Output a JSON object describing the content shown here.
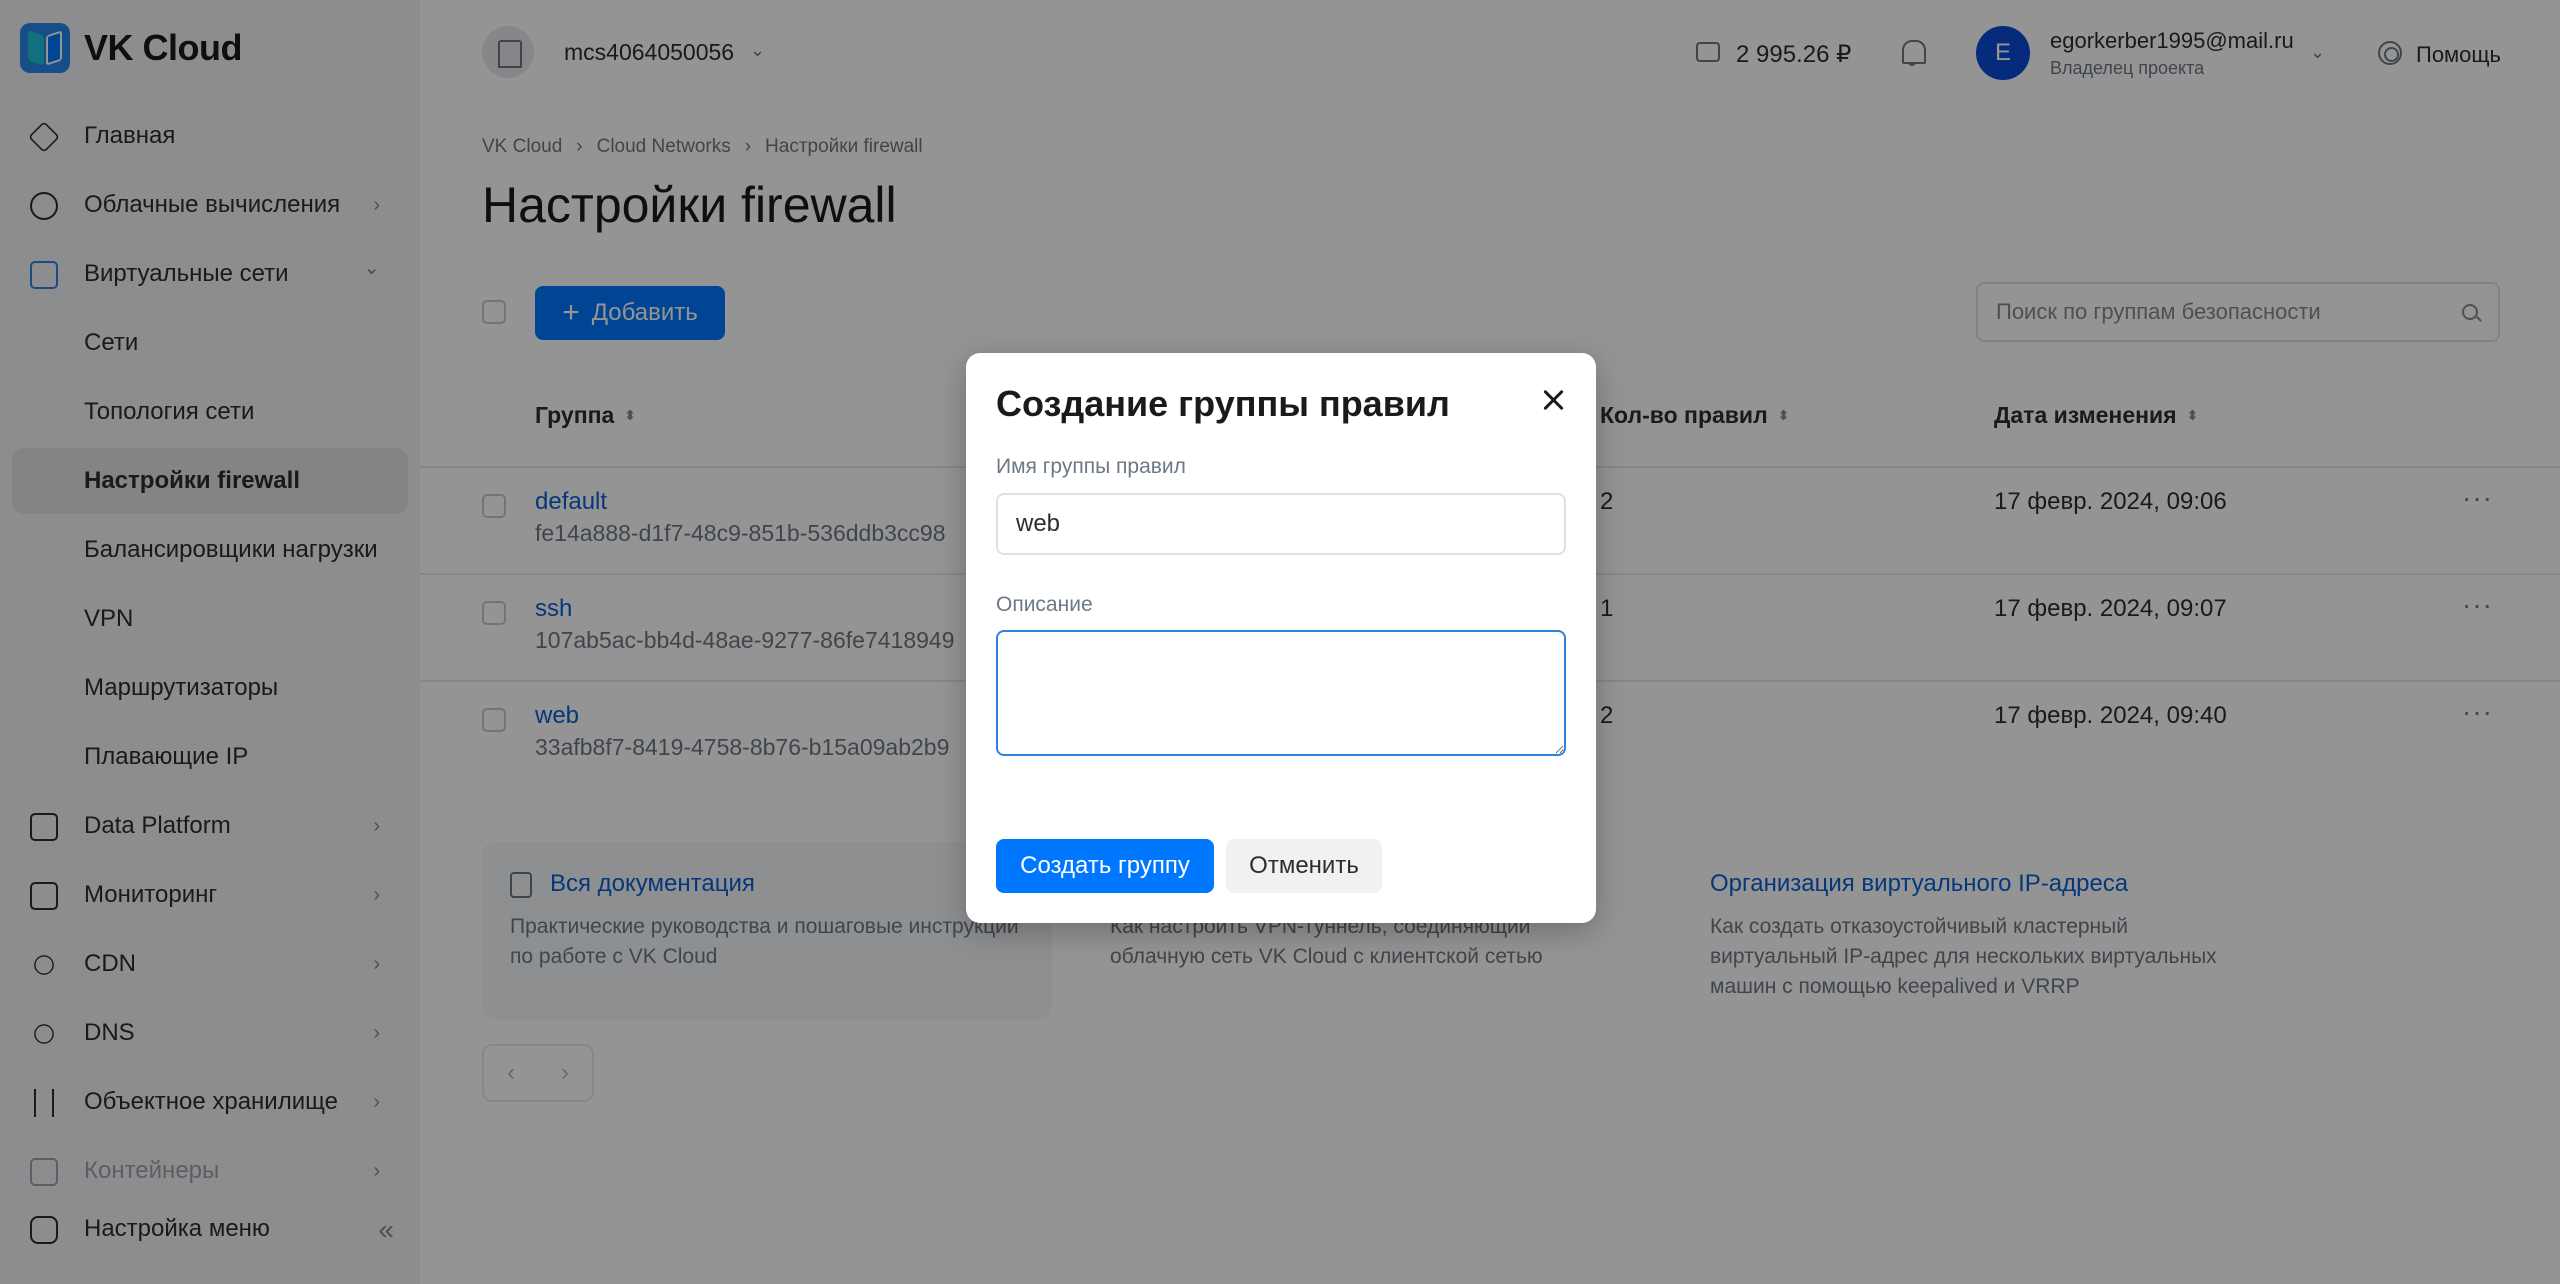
{
  "app": {
    "logo_text": "VK Cloud"
  },
  "sidebar": {
    "items": [
      {
        "label": "Главная",
        "icon": "cube-icon",
        "chevron": ""
      },
      {
        "label": "Облачные вычисления",
        "icon": "compute-icon",
        "chevron": "›"
      },
      {
        "label": "Виртуальные сети",
        "icon": "network-icon",
        "chevron": "⌄"
      },
      {
        "label": "Сети",
        "icon": "",
        "chevron": ""
      },
      {
        "label": "Топология сети",
        "icon": "",
        "chevron": ""
      },
      {
        "label": "Настройки firewall",
        "icon": "",
        "chevron": ""
      },
      {
        "label": "Балансировщики нагрузки",
        "icon": "",
        "chevron": ""
      },
      {
        "label": "VPN",
        "icon": "",
        "chevron": ""
      },
      {
        "label": "Маршрутизаторы",
        "icon": "",
        "chevron": ""
      },
      {
        "label": "Плавающие IP",
        "icon": "",
        "chevron": ""
      },
      {
        "label": "Data Platform",
        "icon": "data-platform-icon",
        "chevron": "›"
      },
      {
        "label": "Мониторинг",
        "icon": "monitoring-icon",
        "chevron": "›"
      },
      {
        "label": "CDN",
        "icon": "cdn-icon",
        "chevron": "›"
      },
      {
        "label": "DNS",
        "icon": "dns-icon",
        "chevron": "›"
      },
      {
        "label": "Объектное хранилище",
        "icon": "storage-icon",
        "chevron": "›"
      },
      {
        "label": "Контейнеры",
        "icon": "containers-icon",
        "chevron": "›"
      }
    ],
    "menu_settings": "Настройка меню",
    "collapse_glyph": "«"
  },
  "topbar": {
    "project": "mcs4064050056",
    "project_chevron": "⌄",
    "balance": "2 995.26 ₽",
    "user_initial": "E",
    "user_email": "egorkerber1995@mail.ru",
    "user_role": "Владелец проекта",
    "user_chevron": "⌄",
    "help": "Помощь"
  },
  "breadcrumb": {
    "items": [
      "VK Cloud",
      "Cloud Networks",
      "Настройки firewall"
    ],
    "separator": "›"
  },
  "page": {
    "title": "Настройки firewall"
  },
  "toolbar": {
    "add_label": "Добавить",
    "add_plus": "+",
    "search_placeholder": "Поиск по группам безопасности"
  },
  "table": {
    "columns": {
      "group": "Группа",
      "rules": "Кол-во правил",
      "date": "Дата изменения",
      "sort_glyph": "⬍"
    },
    "rows": [
      {
        "name": "default",
        "uuid": "fe14a888-d1f7-48c9-851b-536ddb3cc98",
        "rules": "2",
        "date": "17 февр. 2024, 09:06",
        "more": "···"
      },
      {
        "name": "ssh",
        "uuid": "107ab5ac-bb4d-48ae-9277-86fe7418949",
        "rules": "1",
        "date": "17 февр. 2024, 09:07",
        "more": "···"
      },
      {
        "name": "web",
        "uuid": "33afb8f7-8419-4758-8b76-b15a09ab2b9",
        "rules": "2",
        "date": "17 февр. 2024, 09:40",
        "more": "···"
      }
    ]
  },
  "docs": {
    "all": {
      "title": "Вся документация",
      "desc": "Практические руководства и пошаговые инструкции по работе с VK Cloud"
    },
    "vpn": {
      "title": "",
      "desc": "Как настроить VPN-туннель, соединяющий облачную сеть VK Cloud с клиентской сетью"
    },
    "vip": {
      "title": "Организация виртуального IP-адреса",
      "desc": "Как создать отказоустойчивый кластерный виртуальный IP-адрес для нескольких виртуальных машин с помощью keepalived и VRRP"
    }
  },
  "pager": {
    "prev": "‹",
    "next": "›"
  },
  "modal": {
    "title": "Создание группы правил",
    "name_label": "Имя группы правил",
    "name_value": "web",
    "desc_label": "Описание",
    "desc_value": "",
    "create_label": "Создать группу",
    "cancel_label": "Отменить"
  }
}
